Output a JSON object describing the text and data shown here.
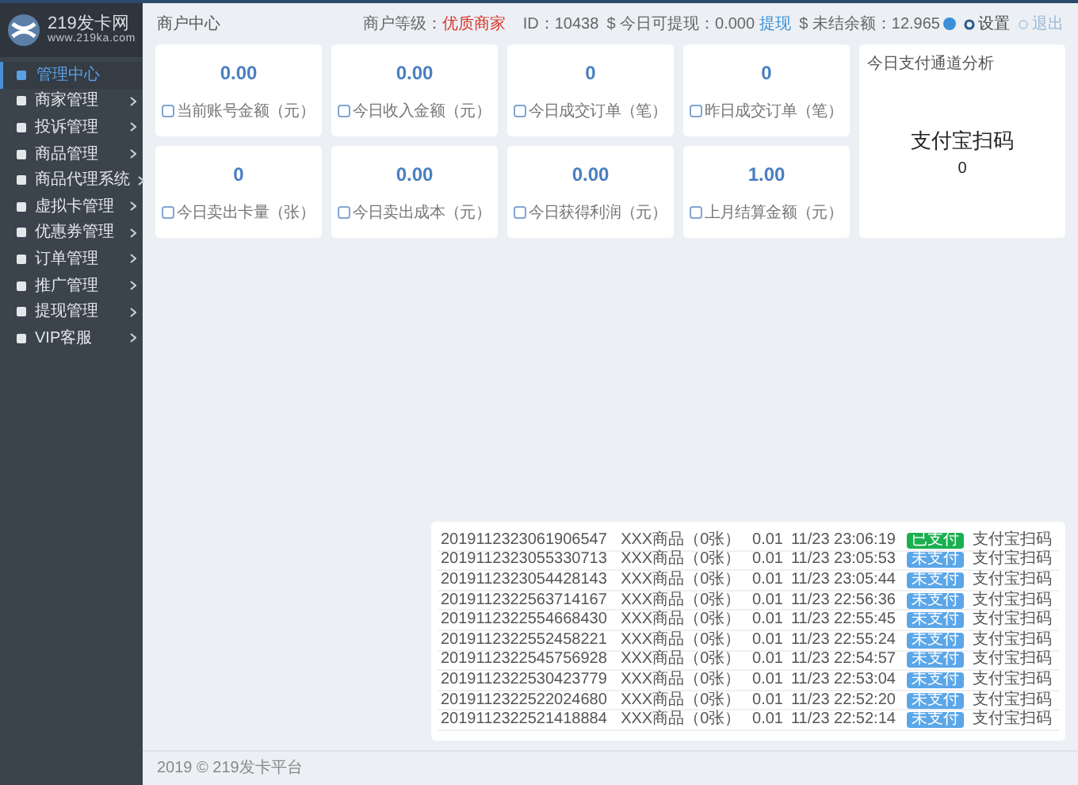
{
  "sidebar": {
    "logo": {
      "title": "219发卡网",
      "url": "www.219ka.com"
    },
    "items": [
      {
        "label": "管理中心",
        "selected": true,
        "expandable": false
      },
      {
        "label": "商家管理",
        "selected": false,
        "expandable": true
      },
      {
        "label": "投诉管理",
        "selected": false,
        "expandable": true
      },
      {
        "label": "商品管理",
        "selected": false,
        "expandable": true
      },
      {
        "label": "商品代理系统",
        "selected": false,
        "expandable": true
      },
      {
        "label": "虚拟卡管理",
        "selected": false,
        "expandable": true
      },
      {
        "label": "优惠券管理",
        "selected": false,
        "expandable": true
      },
      {
        "label": "订单管理",
        "selected": false,
        "expandable": true
      },
      {
        "label": "推广管理",
        "selected": false,
        "expandable": true
      },
      {
        "label": "提现管理",
        "selected": false,
        "expandable": true
      },
      {
        "label": "VIP客服",
        "selected": false,
        "expandable": true
      }
    ]
  },
  "header": {
    "title": "商户中心",
    "level_label": "商户等级：",
    "level_value": "优质商家",
    "id": "ID：10438",
    "withdrawable": "$ 今日可提现：0.000",
    "withdraw_link": "提现",
    "unsettled": "$ 未结余额：12.965",
    "settings": "设置",
    "logout": "退出"
  },
  "stats": [
    {
      "value": "0.00",
      "label": "当前账号金额（元）"
    },
    {
      "value": "0.00",
      "label": "今日收入金额（元）"
    },
    {
      "value": "0",
      "label": "今日成交订单（笔）"
    },
    {
      "value": "0",
      "label": "昨日成交订单（笔）"
    },
    {
      "value": "0",
      "label": "今日卖出卡量（张）"
    },
    {
      "value": "0.00",
      "label": "今日卖出成本（元）"
    },
    {
      "value": "0.00",
      "label": "今日获得利润（元）"
    },
    {
      "value": "1.00",
      "label": "上月结算金额（元）"
    }
  ],
  "channel_card": {
    "title": "今日支付通道分析",
    "channel": "支付宝扫码",
    "count": "0"
  },
  "orders": [
    {
      "order_no": "2019112323061906547",
      "product": "XXX商品（0张）",
      "amount": "0.01",
      "time": "11/23 23:06:19",
      "status": "已支付",
      "paid": true,
      "channel": "支付宝扫码"
    },
    {
      "order_no": "2019112323055330713",
      "product": "XXX商品（0张）",
      "amount": "0.01",
      "time": "11/23 23:05:53",
      "status": "未支付",
      "paid": false,
      "channel": "支付宝扫码"
    },
    {
      "order_no": "2019112323054428143",
      "product": "XXX商品（0张）",
      "amount": "0.01",
      "time": "11/23 23:05:44",
      "status": "未支付",
      "paid": false,
      "channel": "支付宝扫码"
    },
    {
      "order_no": "2019112322563714167",
      "product": "XXX商品（0张）",
      "amount": "0.01",
      "time": "11/23 22:56:36",
      "status": "未支付",
      "paid": false,
      "channel": "支付宝扫码"
    },
    {
      "order_no": "2019112322554668430",
      "product": "XXX商品（0张）",
      "amount": "0.01",
      "time": "11/23 22:55:45",
      "status": "未支付",
      "paid": false,
      "channel": "支付宝扫码"
    },
    {
      "order_no": "2019112322552458221",
      "product": "XXX商品（0张）",
      "amount": "0.01",
      "time": "11/23 22:55:24",
      "status": "未支付",
      "paid": false,
      "channel": "支付宝扫码"
    },
    {
      "order_no": "2019112322545756928",
      "product": "XXX商品（0张）",
      "amount": "0.01",
      "time": "11/23 22:54:57",
      "status": "未支付",
      "paid": false,
      "channel": "支付宝扫码"
    },
    {
      "order_no": "2019112322530423779",
      "product": "XXX商品（0张）",
      "amount": "0.01",
      "time": "11/23 22:53:04",
      "status": "未支付",
      "paid": false,
      "channel": "支付宝扫码"
    },
    {
      "order_no": "2019112322522024680",
      "product": "XXX商品（0张）",
      "amount": "0.01",
      "time": "11/23 22:52:20",
      "status": "未支付",
      "paid": false,
      "channel": "支付宝扫码"
    },
    {
      "order_no": "2019112322521418884",
      "product": "XXX商品（0张）",
      "amount": "0.01",
      "time": "11/23 22:52:14",
      "status": "未支付",
      "paid": false,
      "channel": "支付宝扫码"
    }
  ],
  "footer": "2019 © 219发卡平台"
}
